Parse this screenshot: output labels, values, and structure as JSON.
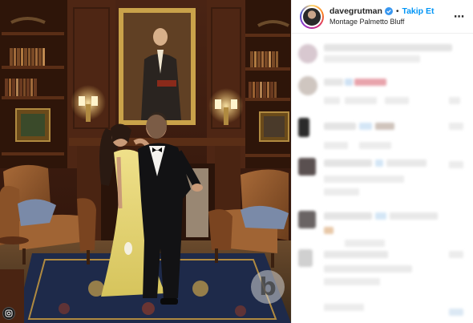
{
  "post": {
    "username": "davegrutman",
    "verified": true,
    "follow_label": "Takip Et",
    "location": "Montage Palmetto Bluff",
    "more_icon": "more-options-icon",
    "separator": "•"
  },
  "media": {
    "watermark_glyph": "b",
    "watermark_icon": "watermark-logo-icon",
    "corner_avatar_icon": "instagram-glyph-icon"
  },
  "colors": {
    "link": "#0095f6",
    "verified_badge": "#3897f0",
    "text": "#262626"
  }
}
